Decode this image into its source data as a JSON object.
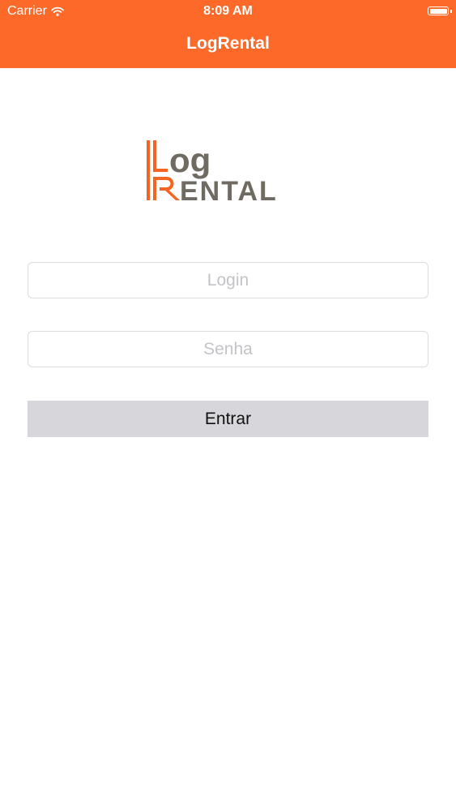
{
  "status_bar": {
    "carrier": "Carrier",
    "time": "8:09 AM"
  },
  "header": {
    "title": "LogRental"
  },
  "logo": {
    "line1": "Log",
    "line2": "Rental",
    "brand_color": "#f26522",
    "text_color": "#6f6b62"
  },
  "login_form": {
    "login_placeholder": "Login",
    "senha_placeholder": "Senha",
    "submit_label": "Entrar"
  },
  "colors": {
    "header_bg": "#fd6928",
    "button_bg": "#d7d6da"
  }
}
